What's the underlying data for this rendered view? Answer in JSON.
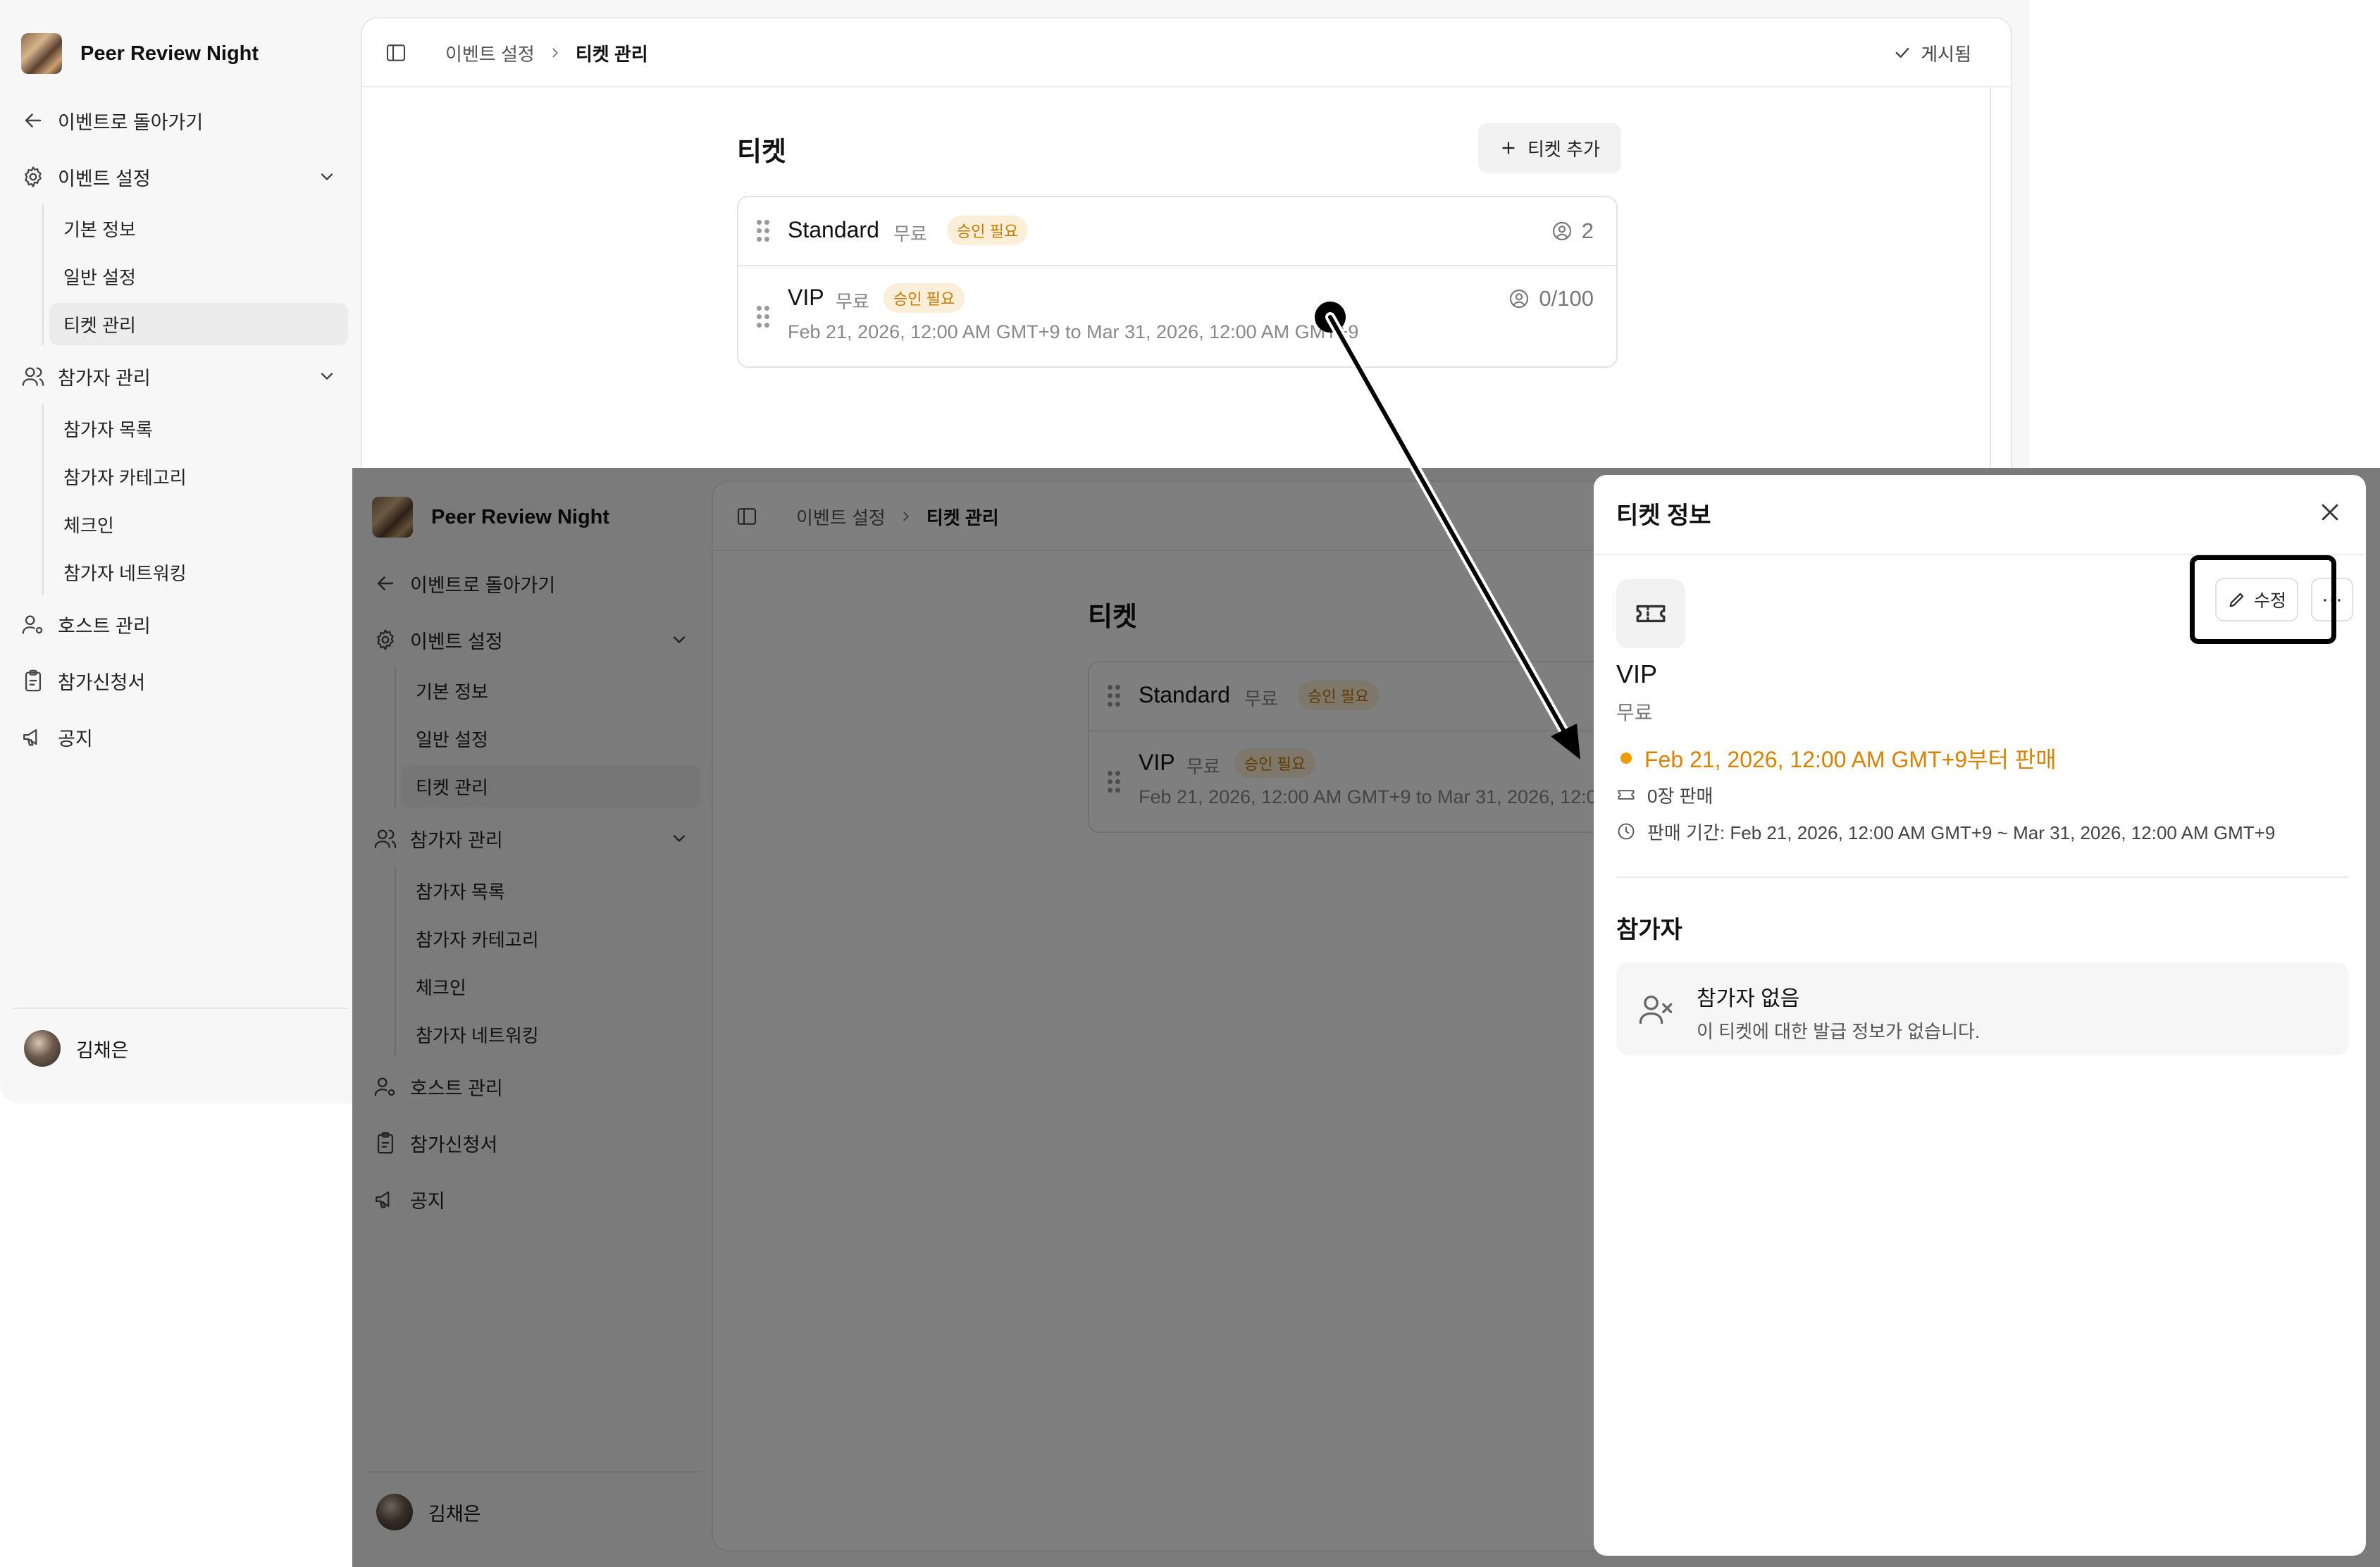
{
  "app": {
    "title": "Peer Review Night",
    "back_label": "이벤트로 돌아가기",
    "user_name": "김채은"
  },
  "sidebar": {
    "event_settings": "이벤트 설정",
    "event_settings_items": [
      "기본 정보",
      "일반 설정",
      "티켓 관리"
    ],
    "participants": "참가자 관리",
    "participants_items": [
      "참가자 목록",
      "참가자 카테고리",
      "체크인",
      "참가자 네트워킹"
    ],
    "host": "호스트 관리",
    "applications": "참가신청서",
    "notice": "공지",
    "active_item": "티켓 관리"
  },
  "header": {
    "breadcrumb_parent": "이벤트 설정",
    "breadcrumb_current": "티켓 관리",
    "publish_status": "게시됨"
  },
  "tickets_page": {
    "title": "티켓",
    "add_button": "티켓 추가",
    "tickets": [
      {
        "name": "Standard",
        "price": "무료",
        "badge": "승인 필요",
        "count": "2",
        "dates": ""
      },
      {
        "name": "VIP",
        "price": "무료",
        "badge": "승인 필요",
        "count": "0/100",
        "dates": "Feb 21, 2026, 12:00 AM GMT+9 to Mar 31, 2026, 12:00 AM GMT+9"
      }
    ]
  },
  "ticket_panel": {
    "title": "티켓 정보",
    "edit_button": "수정",
    "more_button": "···",
    "ticket_name": "VIP",
    "ticket_price": "무료",
    "sale_status": "Feb 21, 2026, 12:00 AM GMT+9부터 판매",
    "sold_count": "0장 판매",
    "sale_period": "판매 기간: Feb 21, 2026, 12:00 AM GMT+9 ~ Mar 31, 2026, 12:00 AM GMT+9",
    "participants_title": "참가자",
    "empty_title": "참가자 없음",
    "empty_desc": "이 티켓에 대한 발급 정보가 없습니다."
  },
  "colors": {
    "accent_orange": "#d98200",
    "badge_bg": "#fbefd9",
    "overlay": "rgba(0,0,0,0.5)"
  },
  "icons": [
    "panel-toggle-icon",
    "chevron-right-icon",
    "check-icon",
    "plus-icon",
    "drag-handle-icon",
    "user-circle-icon",
    "arrow-left-icon",
    "gear-icon",
    "users-icon",
    "user-cog-icon",
    "clipboard-icon",
    "megaphone-icon",
    "chevron-down-icon",
    "close-icon",
    "ticket-icon",
    "pencil-icon",
    "clock-icon",
    "user-x-icon"
  ]
}
